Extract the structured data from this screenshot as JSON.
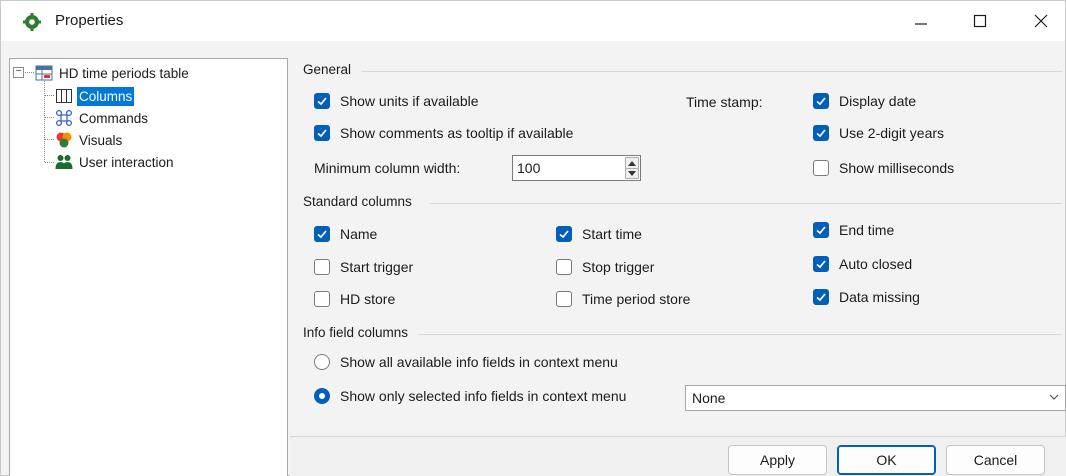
{
  "window": {
    "title": "Properties"
  },
  "tree": {
    "root": "HD time periods table",
    "items": [
      {
        "label": "Columns",
        "icon": "columns-icon",
        "selected": true
      },
      {
        "label": "Commands",
        "icon": "commands-icon",
        "selected": false
      },
      {
        "label": "Visuals",
        "icon": "visuals-icon",
        "selected": false
      },
      {
        "label": "User interaction",
        "icon": "users-icon",
        "selected": false
      }
    ]
  },
  "general": {
    "title": "General",
    "show_units": {
      "label": "Show units if available",
      "checked": true
    },
    "show_comments": {
      "label": "Show comments as tooltip if available",
      "checked": true
    },
    "min_width_label": "Minimum column width:",
    "min_width_value": "100",
    "timestamp_label": "Time stamp:",
    "display_date": {
      "label": "Display date",
      "checked": true
    },
    "two_digit_years": {
      "label": "Use 2-digit years",
      "checked": true
    },
    "show_ms": {
      "label": "Show milliseconds",
      "checked": false
    }
  },
  "standard": {
    "title": "Standard columns",
    "name": {
      "label": "Name",
      "checked": true
    },
    "start_time": {
      "label": "Start time",
      "checked": true
    },
    "end_time": {
      "label": "End time",
      "checked": true
    },
    "start_trigger": {
      "label": "Start trigger",
      "checked": false
    },
    "stop_trigger": {
      "label": "Stop trigger",
      "checked": false
    },
    "auto_closed": {
      "label": "Auto closed",
      "checked": true
    },
    "hd_store": {
      "label": "HD store",
      "checked": false
    },
    "time_period_store": {
      "label": "Time period store",
      "checked": false
    },
    "data_missing": {
      "label": "Data missing",
      "checked": true
    }
  },
  "info": {
    "title": "Info field columns",
    "show_all": {
      "label": "Show all available info fields in context menu",
      "selected": false
    },
    "show_selected": {
      "label": "Show only selected info fields in context menu",
      "selected": true
    },
    "combo_value": "None"
  },
  "footer": {
    "apply": "Apply",
    "ok": "OK",
    "cancel": "Cancel"
  },
  "colors": {
    "accent": "#005fb8",
    "selection": "#0078d7"
  }
}
